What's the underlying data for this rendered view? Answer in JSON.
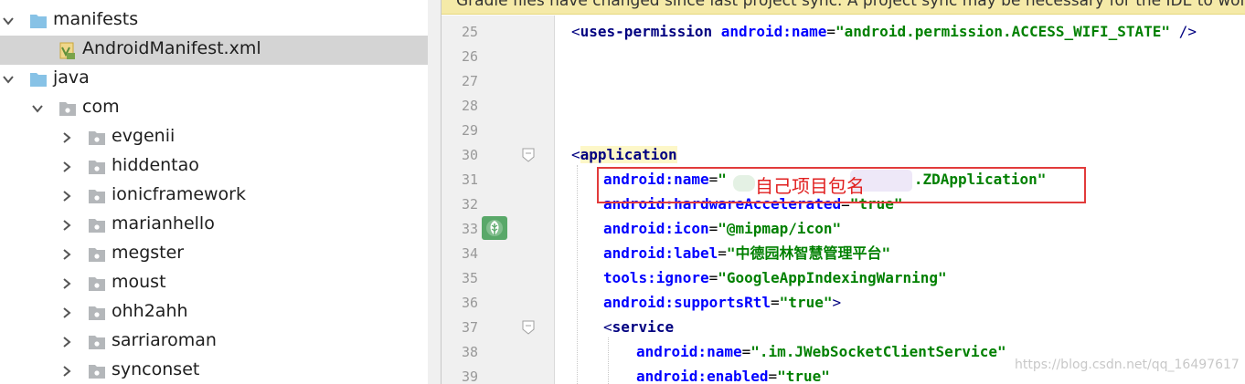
{
  "project_tree": {
    "items": [
      {
        "label": "manifests",
        "kind": "folder",
        "icon": "folder-icon",
        "expanded": true
      },
      {
        "label": "AndroidManifest.xml",
        "kind": "file",
        "icon": "manifest-file-icon",
        "selected": true
      },
      {
        "label": "java",
        "kind": "folder",
        "icon": "folder-icon",
        "expanded": true
      },
      {
        "label": "com",
        "kind": "package",
        "icon": "package-icon",
        "expanded": true
      },
      {
        "label": "evgenii",
        "kind": "package",
        "icon": "package-icon",
        "expanded": false
      },
      {
        "label": "hiddentao",
        "kind": "package",
        "icon": "package-icon",
        "expanded": false
      },
      {
        "label": "ionicframework",
        "kind": "package",
        "icon": "package-icon",
        "expanded": false
      },
      {
        "label": "marianhello",
        "kind": "package",
        "icon": "package-icon",
        "expanded": false
      },
      {
        "label": "megster",
        "kind": "package",
        "icon": "package-icon",
        "expanded": false
      },
      {
        "label": "moust",
        "kind": "package",
        "icon": "package-icon",
        "expanded": false
      },
      {
        "label": "ohh2ahh",
        "kind": "package",
        "icon": "package-icon",
        "expanded": false
      },
      {
        "label": "sarriaroman",
        "kind": "package",
        "icon": "package-icon",
        "expanded": false
      },
      {
        "label": "synconset",
        "kind": "package",
        "icon": "package-icon",
        "expanded": false
      }
    ]
  },
  "editor": {
    "banner": "Gradle files have changed since last project sync. A project sync may be necessary for the IDE to work",
    "line_numbers": [
      "25",
      "26",
      "27",
      "28",
      "29",
      "30",
      "31",
      "32",
      "33",
      "34",
      "35",
      "36",
      "37",
      "38",
      "39"
    ],
    "code": {
      "l25": {
        "open": "<",
        "tag": "uses-permission",
        "attr": "android:name",
        "eq": "=",
        "value": "\"android.permission.ACCESS_WIFI_STATE\"",
        "close": " />"
      },
      "l30": {
        "open": "<",
        "tag": "application"
      },
      "l31": {
        "attr": "android:name",
        "eq": "=",
        "value_start": "\"",
        "value_end": ".ZDApplication\""
      },
      "l32": {
        "attr": "android:hardwareAccelerated",
        "eq": "=",
        "value": "\"true\""
      },
      "l33": {
        "attr": "android:icon",
        "eq": "=",
        "value": "\"@mipmap/icon\""
      },
      "l34": {
        "attr": "android:label",
        "eq": "=",
        "value": "\"中德园林智慧管理平台\""
      },
      "l35": {
        "attr": "tools:ignore",
        "eq": "=",
        "value": "\"GoogleAppIndexingWarning\""
      },
      "l36": {
        "attr": "android:supportsRtl",
        "eq": "=",
        "value": "\"true\"",
        "close": ">"
      },
      "l37": {
        "open": "<",
        "tag": "service"
      },
      "l38": {
        "attr": "android:name",
        "eq": "=",
        "value": "\".im.JWebSocketClientService\""
      },
      "l39": {
        "attr": "android:enabled",
        "eq": "=",
        "value": "\"true\""
      }
    },
    "gutter_icon": "android-icon",
    "annotation": "自己项目包名",
    "annotation_color": "#e23b3b"
  },
  "watermark": "https://blog.csdn.net/qq_16497617",
  "colors": {
    "selection": "#d4d4d4",
    "banner": "#f5eaa8",
    "xml_tag": "#000080",
    "xml_attr": "#0000ff",
    "xml_value": "#008000"
  }
}
